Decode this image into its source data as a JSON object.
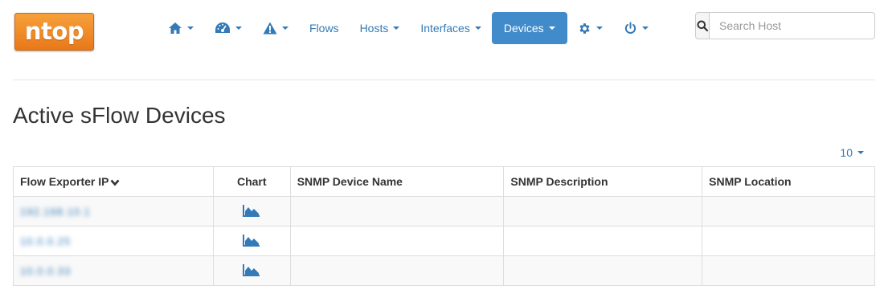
{
  "logo": {
    "text": "ntop"
  },
  "nav": {
    "flows_label": "Flows",
    "hosts_label": "Hosts",
    "interfaces_label": "Interfaces",
    "devices_label": "Devices"
  },
  "search": {
    "placeholder": "Search Host"
  },
  "page": {
    "title": "Active sFlow Devices"
  },
  "pagination": {
    "page_size": "10"
  },
  "table": {
    "headers": {
      "exporter_ip": "Flow Exporter IP",
      "chart": "Chart",
      "snmp_name": "SNMP Device Name",
      "snmp_description": "SNMP Description",
      "snmp_location": "SNMP Location"
    },
    "rows": [
      {
        "exporter_ip": "192.168.10.1",
        "snmp_name": "",
        "snmp_description": "",
        "snmp_location": ""
      },
      {
        "exporter_ip": "10.0.0.25",
        "snmp_name": "",
        "snmp_description": "",
        "snmp_location": ""
      },
      {
        "exporter_ip": "10.0.0.33",
        "snmp_name": "",
        "snmp_description": "",
        "snmp_location": ""
      }
    ]
  },
  "colors": {
    "link": "#337ab7",
    "active_nav": "#428bca",
    "logo_orange": "#f08a24"
  },
  "icons": [
    "home-icon",
    "dashboard-icon",
    "alert-icon",
    "gear-icon",
    "power-icon",
    "search-icon",
    "area-chart-icon",
    "chevron-down-icon"
  ]
}
